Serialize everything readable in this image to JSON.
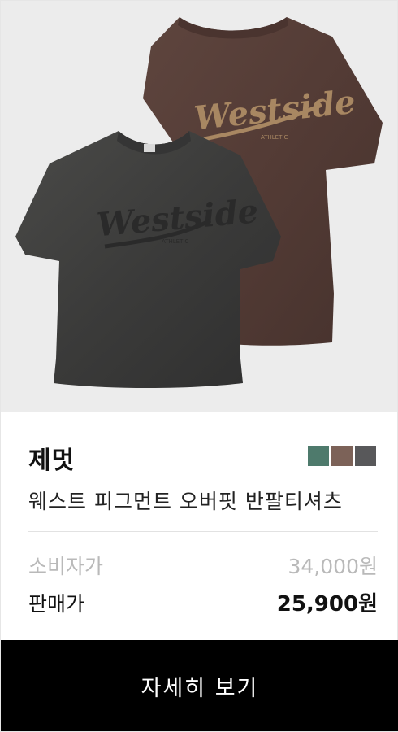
{
  "product": {
    "image_alt": "Westside pigment oversized tee product photo",
    "brand": "제멋",
    "name": "웨스트 피그먼트 오버핏 반팔티셔츠",
    "color_swatches": [
      {
        "name": "green",
        "hex": "#4e7a6c"
      },
      {
        "name": "brown",
        "hex": "#7c6258"
      },
      {
        "name": "charcoal",
        "hex": "#58585a"
      }
    ]
  },
  "prices": {
    "msrp_label": "소비자가",
    "msrp_value": "34,000원",
    "sale_label": "판매가",
    "sale_value": "25,900원"
  },
  "actions": {
    "detail_button": "자세히 보기"
  },
  "colors": {
    "image_background": "#ececec",
    "button_background": "#000000",
    "msrp_text": "#b9b9b9"
  }
}
